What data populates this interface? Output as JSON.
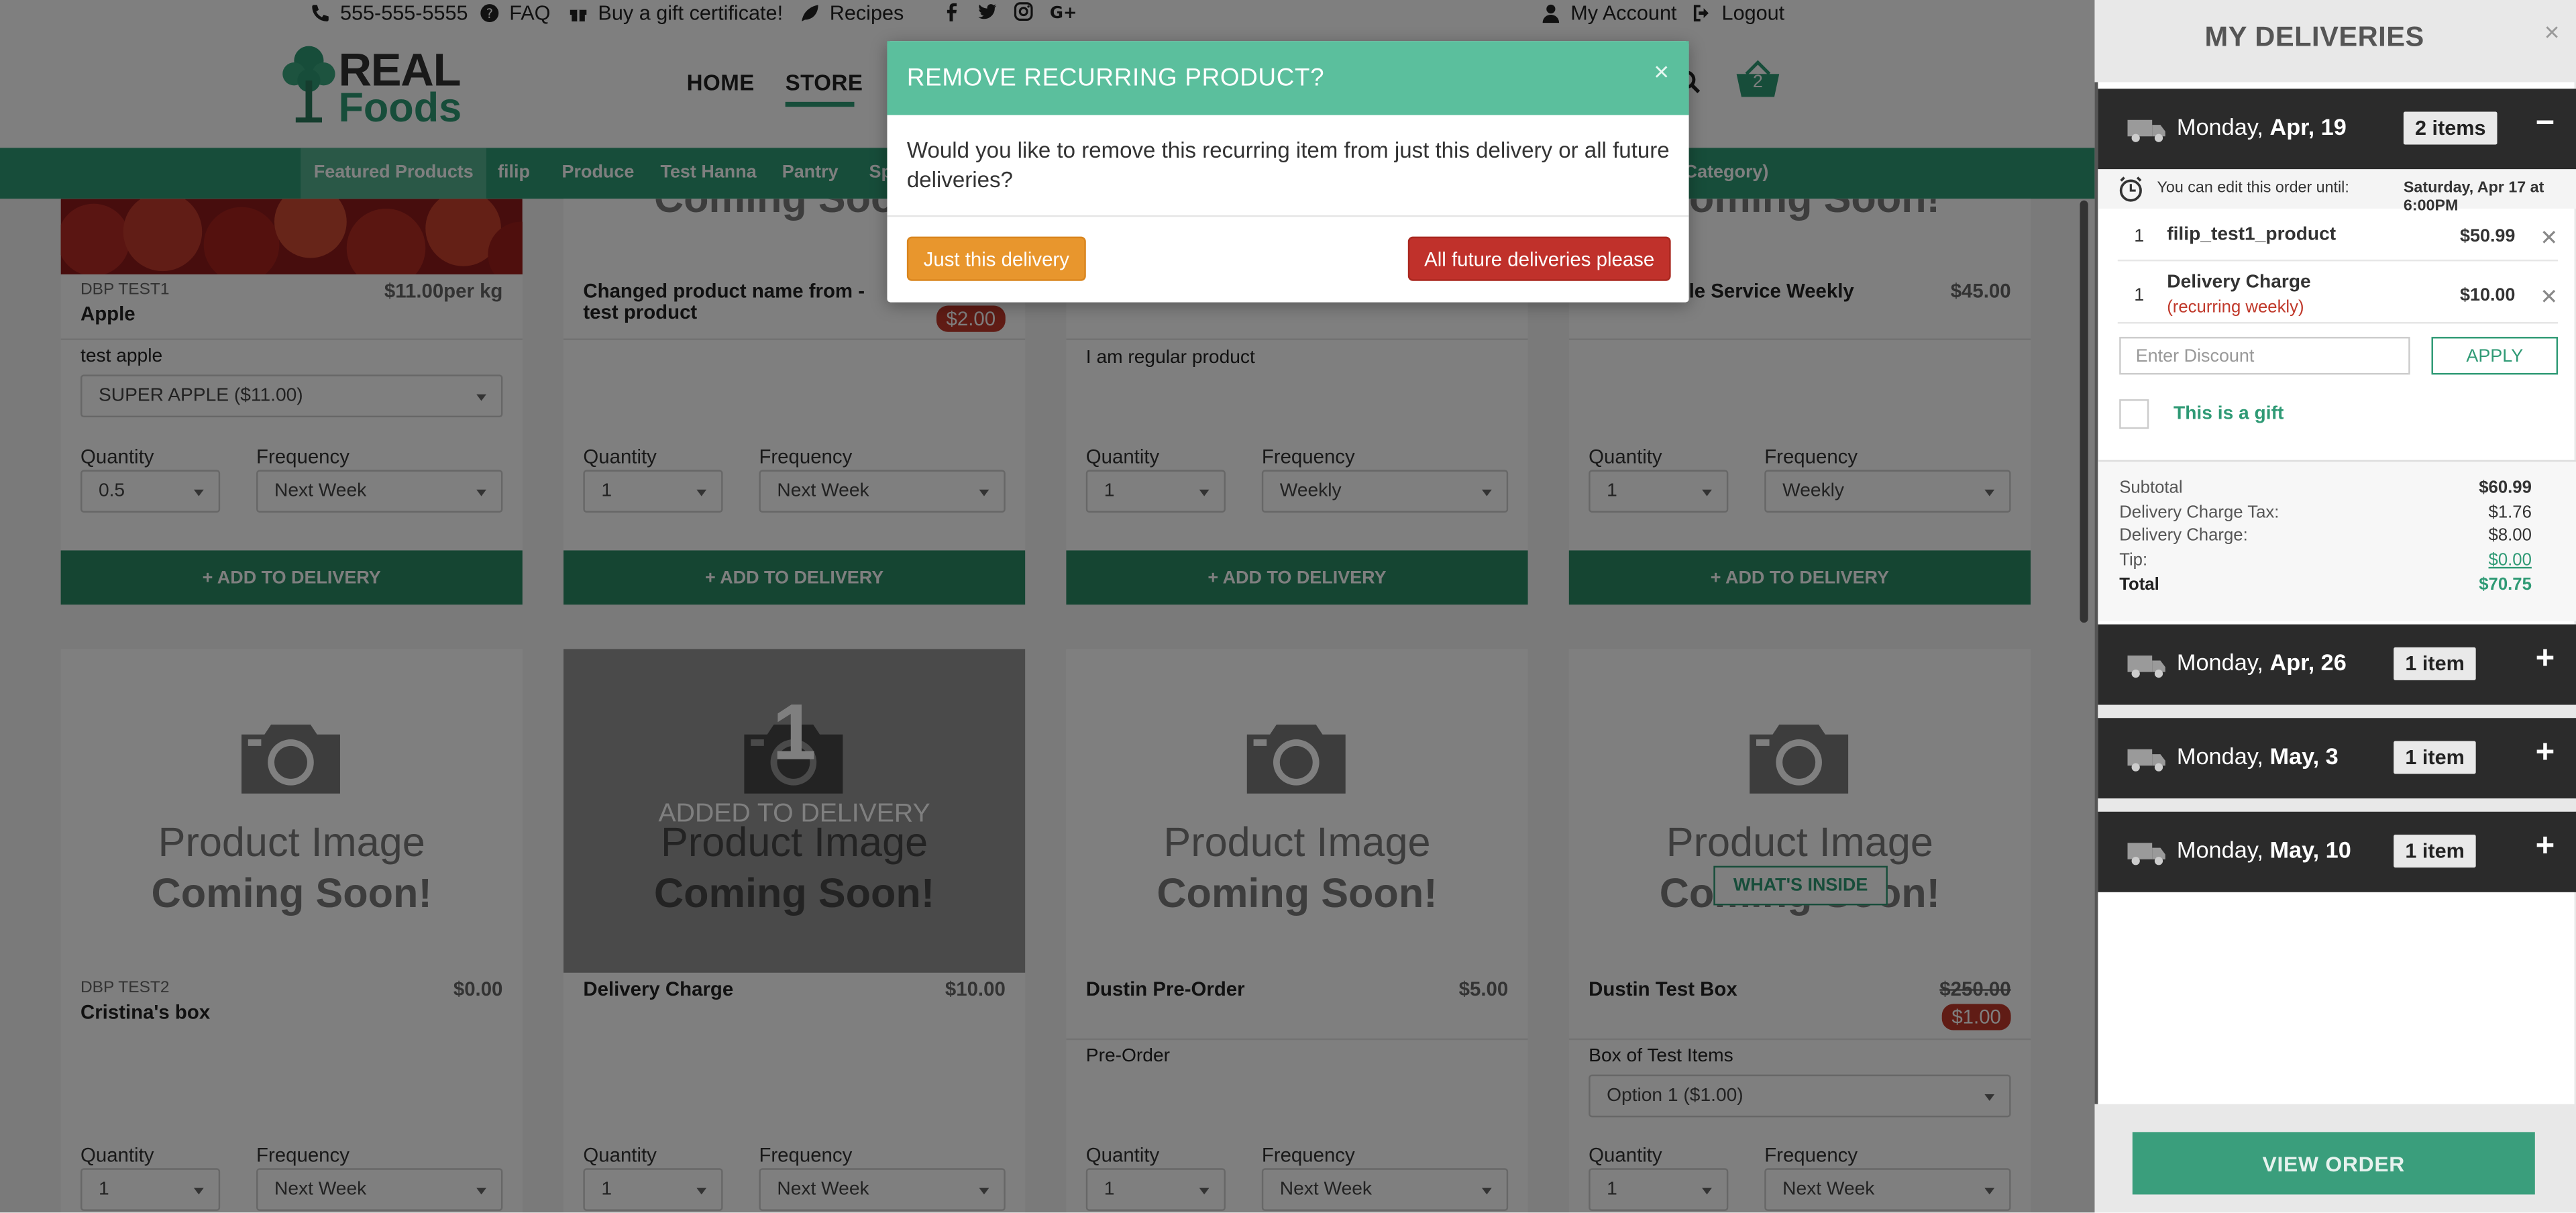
{
  "topbar": {
    "phone": "555-555-5555",
    "faq": "FAQ",
    "gift": "Buy a gift certificate!",
    "recipes": "Recipes",
    "account": "My Account",
    "logout": "Logout"
  },
  "logo": {
    "line1": "REAL",
    "line2": "Foods"
  },
  "nav": {
    "home": "HOME",
    "store": "STORE",
    "cart_count": "2"
  },
  "categories": [
    "Featured Products",
    "filip",
    "Produce",
    "Test Hanna",
    "Pantry",
    "Sp",
    "s Category)"
  ],
  "placeholder": {
    "line1": "Product Image",
    "line2": "Coming Soon!"
  },
  "row1": [
    {
      "sku": "DBP TEST1",
      "title": "Apple",
      "price": "$11.00per kg",
      "desc": "test apple",
      "option": "SUPER APPLE ($11.00)",
      "qty": "0.5",
      "freq": "Next Week"
    },
    {
      "sku": "",
      "title": "Changed product name from - test product",
      "price": "",
      "badge": "$2.00",
      "desc": "",
      "qty": "1",
      "freq": "Next Week"
    },
    {
      "sku": "",
      "title": "",
      "price": "",
      "desc": "I am regular product",
      "qty": "1",
      "freq": "Weekly"
    },
    {
      "sku": "",
      "title": "le Service Weekly",
      "price": "$45.00",
      "desc": "",
      "qty": "1",
      "freq": "Weekly"
    }
  ],
  "row2": [
    {
      "sku": "DBP TEST2",
      "title": "Cristina's box",
      "price": "$0.00",
      "desc": "",
      "qty": "1",
      "freq": "Next Week"
    },
    {
      "sku": "",
      "title": "Delivery Charge",
      "price": "$10.00",
      "desc": "",
      "qty": "1",
      "freq": "Next Week",
      "overlay_num": "1",
      "overlay_text": "ADDED TO DELIVERY"
    },
    {
      "sku": "",
      "title": "Dustin Pre-Order",
      "price": "$5.00",
      "desc": "Pre-Order",
      "qty": "1",
      "freq": "Next Week"
    },
    {
      "sku": "",
      "title": "Dustin Test Box",
      "price": "$250.00",
      "badge": "$1.00",
      "desc": "Box of Test Items",
      "option": "Option 1 ($1.00)",
      "qty": "1",
      "freq": "Next Week",
      "inside": "WHAT'S INSIDE"
    }
  ],
  "labels": {
    "quantity": "Quantity",
    "frequency": "Frequency",
    "add": "ADD TO DELIVERY"
  },
  "modal": {
    "title": "REMOVE RECURRING PRODUCT?",
    "close": "×",
    "body": "Would you like to remove this recurring item from just this delivery or all future deliveries?",
    "btn_this": "Just this delivery",
    "btn_all": "All future deliveries please"
  },
  "panel": {
    "title": "MY DELIVERIES",
    "close": "×",
    "deliveries": [
      {
        "day": "Monday,",
        "date": "Apr, 19",
        "count": "2 items",
        "toggle": "−"
      },
      {
        "day": "Monday,",
        "date": "Apr, 26",
        "count": "1 item",
        "toggle": "+"
      },
      {
        "day": "Monday,",
        "date": "May, 3",
        "count": "1 item",
        "toggle": "+"
      },
      {
        "day": "Monday,",
        "date": "May, 10",
        "count": "1 item",
        "toggle": "+"
      }
    ],
    "edit_note": "You can edit this order until:",
    "edit_until": "Saturday, Apr 17 at 6:00PM",
    "items": [
      {
        "qty": "1",
        "name": "filip_test1_product",
        "price": "$50.99",
        "note": ""
      },
      {
        "qty": "1",
        "name": "Delivery Charge",
        "price": "$10.00",
        "note": "(recurring weekly)"
      }
    ],
    "discount_placeholder": "Enter Discount",
    "apply": "APPLY",
    "gift": "This is a gift",
    "totals": [
      {
        "label": "Subtotal",
        "value": "$60.99"
      },
      {
        "label": "Delivery Charge Tax:",
        "value": "$1.76"
      },
      {
        "label": "Delivery Charge:",
        "value": "$8.00"
      },
      {
        "label": "Tip:",
        "value": "$0.00"
      },
      {
        "label": "Total",
        "value": "$70.75"
      }
    ],
    "view_order": "VIEW ORDER"
  },
  "colors": {
    "brand_green": "#2f9a75",
    "modal_header": "#5bbf9d",
    "orange": "#e8962d",
    "red": "#c0312b"
  }
}
